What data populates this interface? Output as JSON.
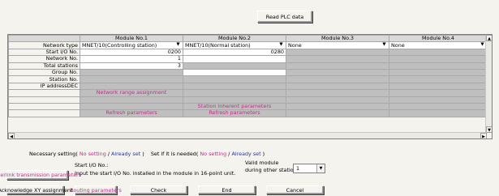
{
  "top_button": "Read PLC data",
  "columns": [
    "Module No.1",
    "Module No.2",
    "Module No.3",
    "Module No.4"
  ],
  "rows": {
    "network_type": "Network type",
    "start_io": "Start I/O No.",
    "network_no": "Network No.",
    "total_stations": "Total stations",
    "group_no": "Group No.",
    "station_no": "Station No.",
    "ip_address": "IP addressDEC"
  },
  "values": {
    "m1_network_type": "MNET/10(Controlling station)",
    "m2_network_type": "MNET/10(Normal station)",
    "m3_network_type": "None",
    "m4_network_type": "None",
    "m1_start_io": "0200",
    "m2_start_io": "0280",
    "m1_network_no": "1",
    "m1_total_stations": "3"
  },
  "links": {
    "network_range": "Network range assignment",
    "station_inherent": "Station inherent parameters",
    "refresh1": "Refresh parameters",
    "refresh2": "Refresh parameters"
  },
  "legend": {
    "necessary": "Necessary setting(",
    "no_setting": "No setting",
    "slash1": "/",
    "already_set": "Already set",
    "close1": ")",
    "set_if_needed": "Set if it is needed(",
    "no_setting2": "No setting",
    "slash2": "/",
    "already_set2": "Already set",
    "close2": ")"
  },
  "hint": {
    "title": "Start I/O No.:",
    "body": "Input the start I/O No. installed in the module in 16-point unit."
  },
  "valid_module": {
    "label1": "Valid module",
    "label2": "during other station access",
    "value": "1"
  },
  "buttons": {
    "interlink": "Interlink transmission parameters",
    "acknowledge": "Acknowledge XY assignment",
    "routing": "Routing parameters",
    "check": "Check",
    "end": "End",
    "cancel": "Cancel"
  },
  "colors": {
    "pink": "#c0308a",
    "blue": "#2a3a9a"
  }
}
